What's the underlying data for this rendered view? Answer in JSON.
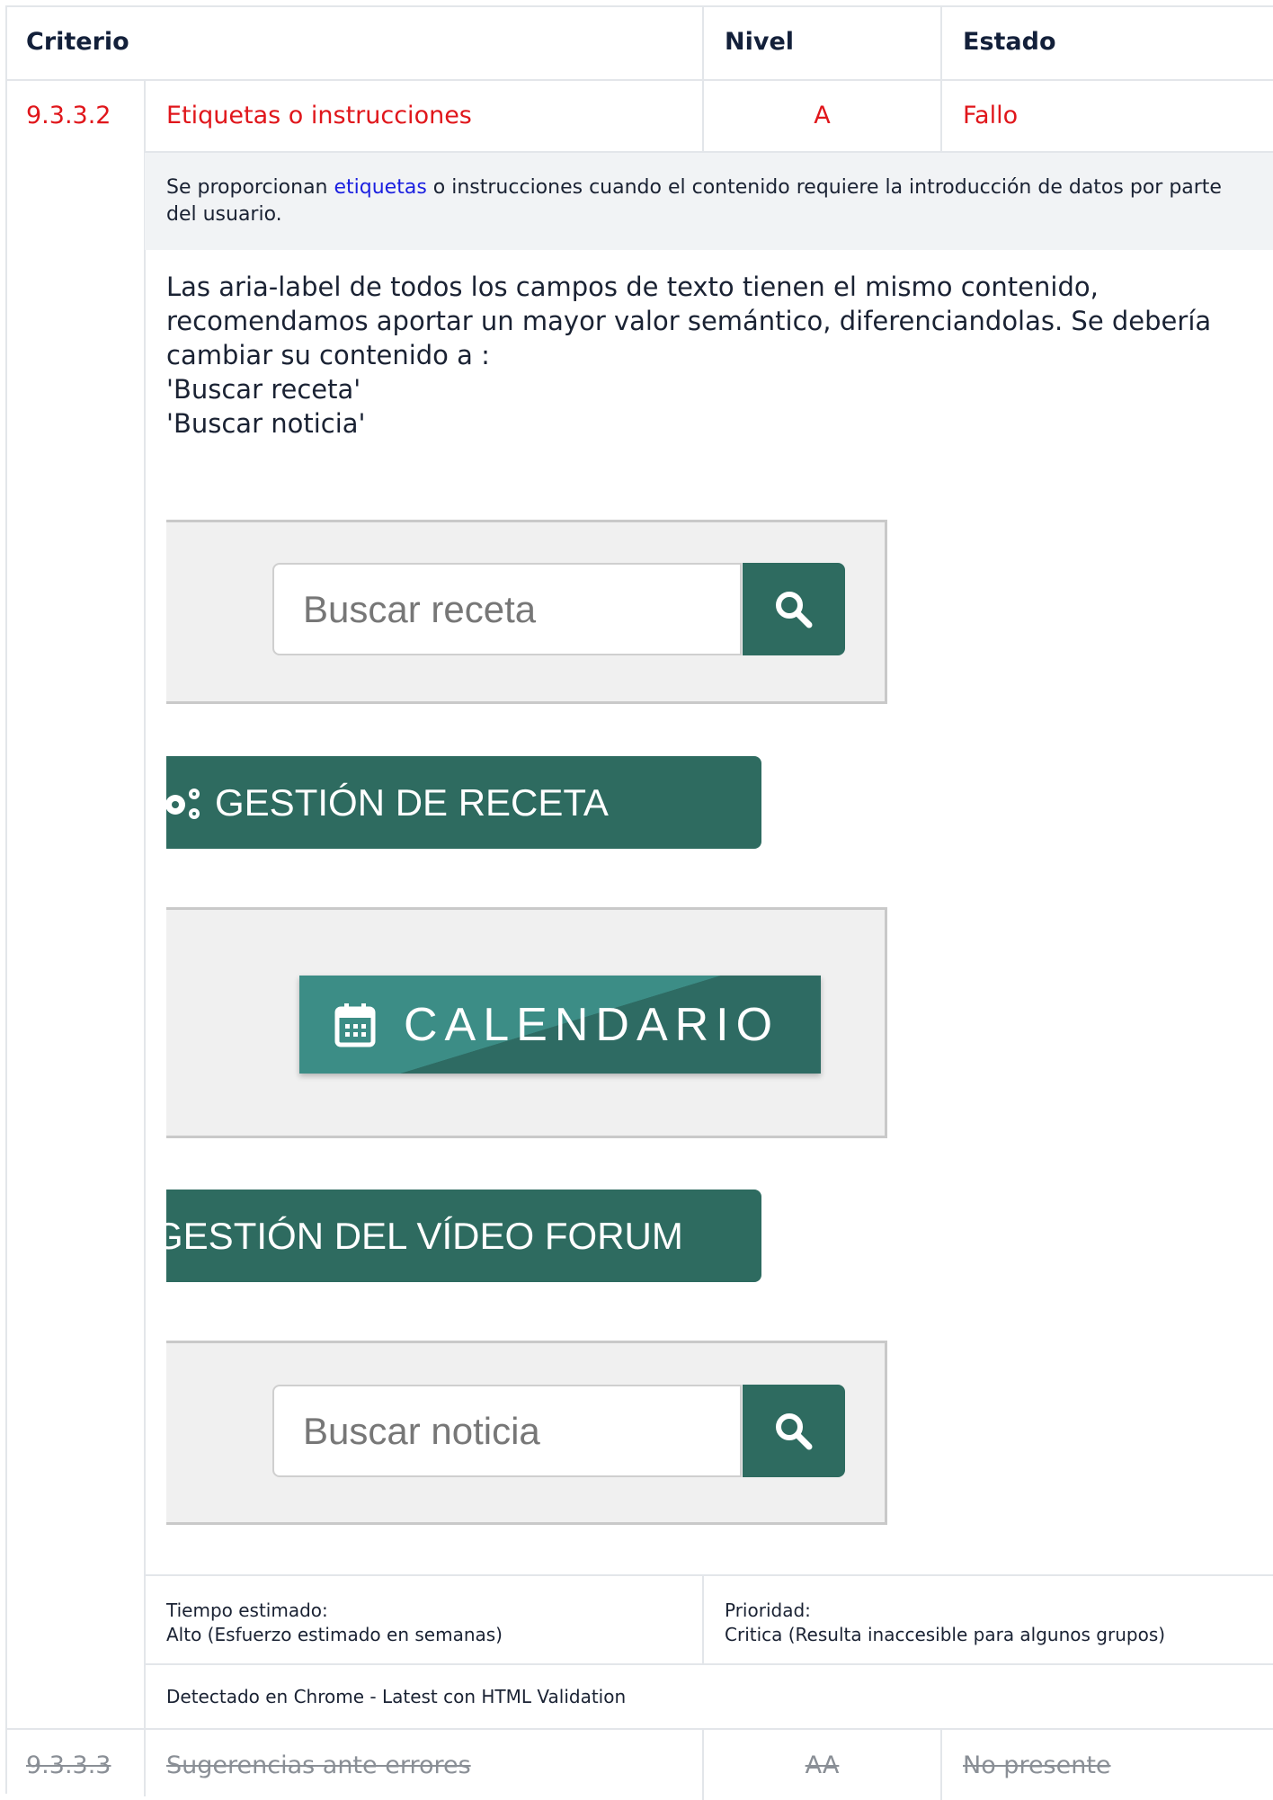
{
  "header": {
    "criterio": "Criterio",
    "nivel": "Nivel",
    "estado": "Estado"
  },
  "row1": {
    "code": "9.3.3.2",
    "title": "Etiquetas o instrucciones",
    "level": "A",
    "status": "Fallo",
    "description": {
      "before": "Se proporcionan ",
      "link": "etiquetas",
      "after": " o instrucciones cuando el contenido requiere la introducción de datos por parte del usuario."
    },
    "note_lines": [
      "Las aria-label de todos los campos de texto tienen el mismo contenido,",
      "recomendamos aportar un mayor valor semántico, diferenciandolas. Se debería",
      "cambiar su contenido a :",
      "'Buscar receta'",
      "'Buscar noticia'"
    ],
    "screenshots": {
      "search1_placeholder": "Buscar receta",
      "banner1": "GESTIÓN DE RECETA",
      "calendar": "CALENDARIO",
      "banner2": "GESTIÓN DEL VÍDEO FORUM",
      "search2_placeholder": "Buscar noticia"
    },
    "time_label": "Tiempo estimado:",
    "time_value": "Alto (Esfuerzo estimado en semanas)",
    "priority_label": "Prioridad:",
    "priority_value": "Critica (Resulta inaccesible para algunos grupos)",
    "detected": "Detectado en Chrome - Latest con HTML Validation"
  },
  "row2": {
    "code": "9.3.3.3",
    "title": "Sugerencias ante errores",
    "level": "AA",
    "status": "No presente"
  },
  "colors": {
    "accent_green": "#2e6b60",
    "fail_red": "#e0161b",
    "link_blue": "#1a1fe0"
  }
}
